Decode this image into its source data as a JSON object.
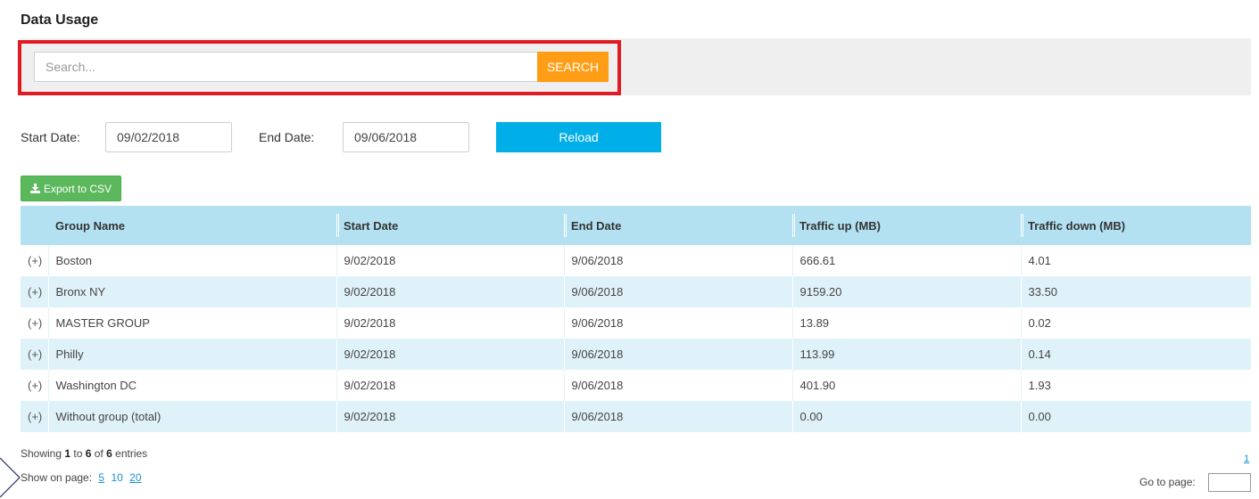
{
  "page": {
    "title": "Data Usage"
  },
  "search": {
    "placeholder": "Search...",
    "value": "",
    "button_label": "SEARCH",
    "highlight_color": "#e01b24",
    "button_color": "#ff9e16"
  },
  "filters": {
    "start_label": "Start Date:",
    "start_value": "09/02/2018",
    "end_label": "End Date:",
    "end_value": "09/06/2018",
    "reload_label": "Reload",
    "reload_color": "#00aee8"
  },
  "export": {
    "label": "Export to CSV",
    "icon": "download-icon",
    "color": "#5cb85c"
  },
  "table": {
    "columns": [
      "Group Name",
      "Start Date",
      "End Date",
      "Traffic up (MB)",
      "Traffic down (MB)"
    ],
    "expand_label": "(+)",
    "rows": [
      {
        "group": "Boston",
        "start": "9/02/2018",
        "end": "9/06/2018",
        "up": "666.61",
        "down": "4.01"
      },
      {
        "group": "Bronx NY",
        "start": "9/02/2018",
        "end": "9/06/2018",
        "up": "9159.20",
        "down": "33.50"
      },
      {
        "group": "MASTER GROUP",
        "start": "9/02/2018",
        "end": "9/06/2018",
        "up": "13.89",
        "down": "0.02"
      },
      {
        "group": "Philly",
        "start": "9/02/2018",
        "end": "9/06/2018",
        "up": "113.99",
        "down": "0.14"
      },
      {
        "group": "Washington DC",
        "start": "9/02/2018",
        "end": "9/06/2018",
        "up": "401.90",
        "down": "1.93"
      },
      {
        "group": "Without group (total)",
        "start": "9/02/2018",
        "end": "9/06/2018",
        "up": "0.00",
        "down": "0.00"
      }
    ]
  },
  "footer": {
    "showing_prefix": "Showing ",
    "showing_from": "1",
    "showing_to_word": " to ",
    "showing_to": "6",
    "showing_of_word": " of ",
    "showing_total": "6",
    "showing_suffix": " entries",
    "show_on_page_label": "Show on page:",
    "page_sizes": [
      "5",
      "10",
      "20"
    ],
    "current_page": "1",
    "goto_label": "Go to page:",
    "goto_value": ""
  }
}
